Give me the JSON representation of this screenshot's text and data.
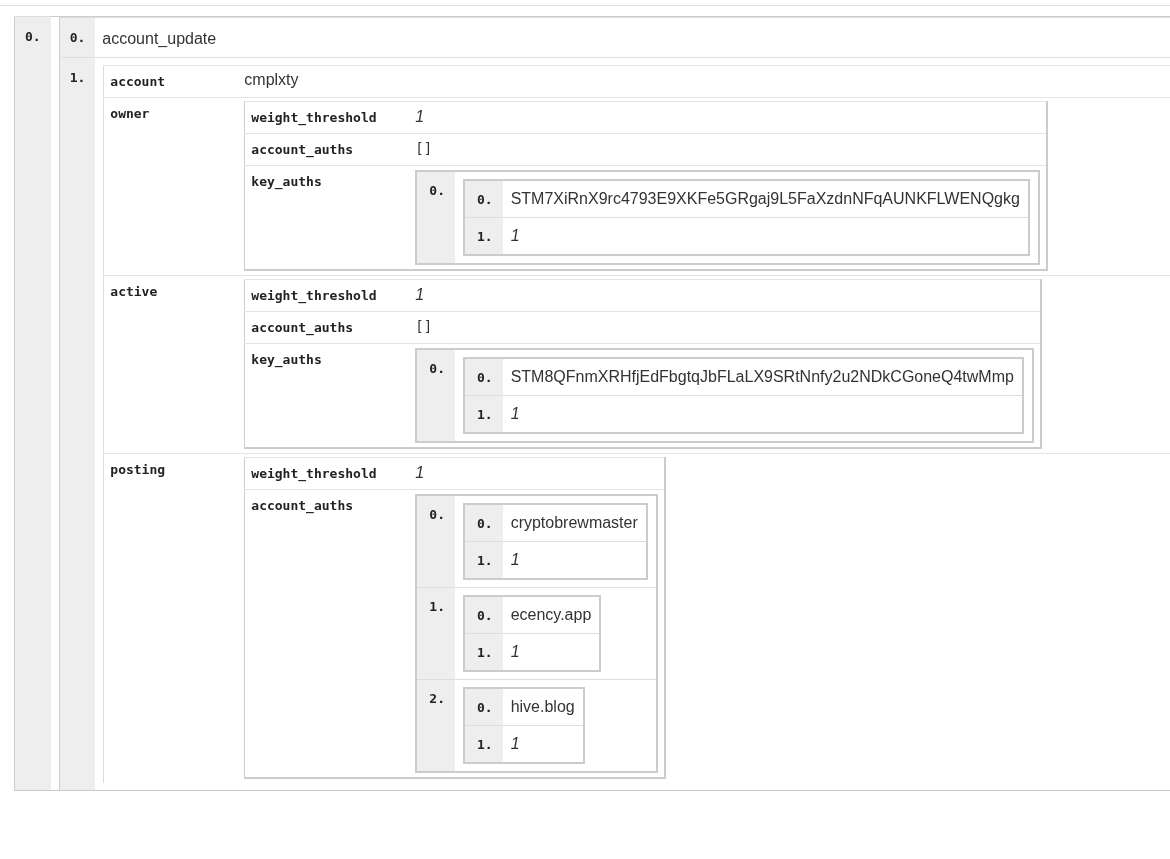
{
  "root": {
    "kind": "array",
    "items": [
      {
        "index": "0.",
        "value": {
          "kind": "array",
          "items": [
            {
              "index": "0.",
              "value": {
                "kind": "string",
                "text": "account_update"
              }
            },
            {
              "index": "1.",
              "value": {
                "kind": "object",
                "entries": [
                  {
                    "key": "account",
                    "value": {
                      "kind": "string",
                      "text": "cmplxty"
                    }
                  },
                  {
                    "key": "owner",
                    "value": {
                      "kind": "object",
                      "entries": [
                        {
                          "key": "weight_threshold",
                          "value": {
                            "kind": "number",
                            "text": "1"
                          }
                        },
                        {
                          "key": "account_auths",
                          "value": {
                            "kind": "empty",
                            "text": "[]"
                          }
                        },
                        {
                          "key": "key_auths",
                          "value": {
                            "kind": "array",
                            "items": [
                              {
                                "index": "0.",
                                "value": {
                                  "kind": "array",
                                  "items": [
                                    {
                                      "index": "0.",
                                      "value": {
                                        "kind": "string",
                                        "text": "STM7XiRnX9rc4793E9XKFe5GRgaj9L5FaXzdnNFqAUNKFLWENQgkg"
                                      }
                                    },
                                    {
                                      "index": "1.",
                                      "value": {
                                        "kind": "number",
                                        "text": "1"
                                      }
                                    }
                                  ]
                                }
                              }
                            ]
                          }
                        }
                      ]
                    }
                  },
                  {
                    "key": "active",
                    "value": {
                      "kind": "object",
                      "entries": [
                        {
                          "key": "weight_threshold",
                          "value": {
                            "kind": "number",
                            "text": "1"
                          }
                        },
                        {
                          "key": "account_auths",
                          "value": {
                            "kind": "empty",
                            "text": "[]"
                          }
                        },
                        {
                          "key": "key_auths",
                          "value": {
                            "kind": "array",
                            "items": [
                              {
                                "index": "0.",
                                "value": {
                                  "kind": "array",
                                  "items": [
                                    {
                                      "index": "0.",
                                      "value": {
                                        "kind": "string",
                                        "text": "STM8QFnmXRHfjEdFbgtqJbFLaLX9SRtNnfy2u2NDkCGoneQ4twMmp"
                                      }
                                    },
                                    {
                                      "index": "1.",
                                      "value": {
                                        "kind": "number",
                                        "text": "1"
                                      }
                                    }
                                  ]
                                }
                              }
                            ]
                          }
                        }
                      ]
                    }
                  },
                  {
                    "key": "posting",
                    "value": {
                      "kind": "object",
                      "entries": [
                        {
                          "key": "weight_threshold",
                          "value": {
                            "kind": "number",
                            "text": "1"
                          }
                        },
                        {
                          "key": "account_auths",
                          "value": {
                            "kind": "array",
                            "items": [
                              {
                                "index": "0.",
                                "value": {
                                  "kind": "array",
                                  "items": [
                                    {
                                      "index": "0.",
                                      "value": {
                                        "kind": "string",
                                        "text": "cryptobrewmaster"
                                      }
                                    },
                                    {
                                      "index": "1.",
                                      "value": {
                                        "kind": "number",
                                        "text": "1"
                                      }
                                    }
                                  ]
                                }
                              },
                              {
                                "index": "1.",
                                "value": {
                                  "kind": "array",
                                  "items": [
                                    {
                                      "index": "0.",
                                      "value": {
                                        "kind": "string",
                                        "text": "ecency.app"
                                      }
                                    },
                                    {
                                      "index": "1.",
                                      "value": {
                                        "kind": "number",
                                        "text": "1"
                                      }
                                    }
                                  ]
                                }
                              },
                              {
                                "index": "2.",
                                "value": {
                                  "kind": "array",
                                  "items": [
                                    {
                                      "index": "0.",
                                      "value": {
                                        "kind": "string",
                                        "text": "hive.blog"
                                      }
                                    },
                                    {
                                      "index": "1.",
                                      "value": {
                                        "kind": "number",
                                        "text": "1"
                                      }
                                    }
                                  ]
                                }
                              }
                            ]
                          }
                        }
                      ]
                    }
                  }
                ]
              }
            }
          ]
        }
      }
    ]
  }
}
